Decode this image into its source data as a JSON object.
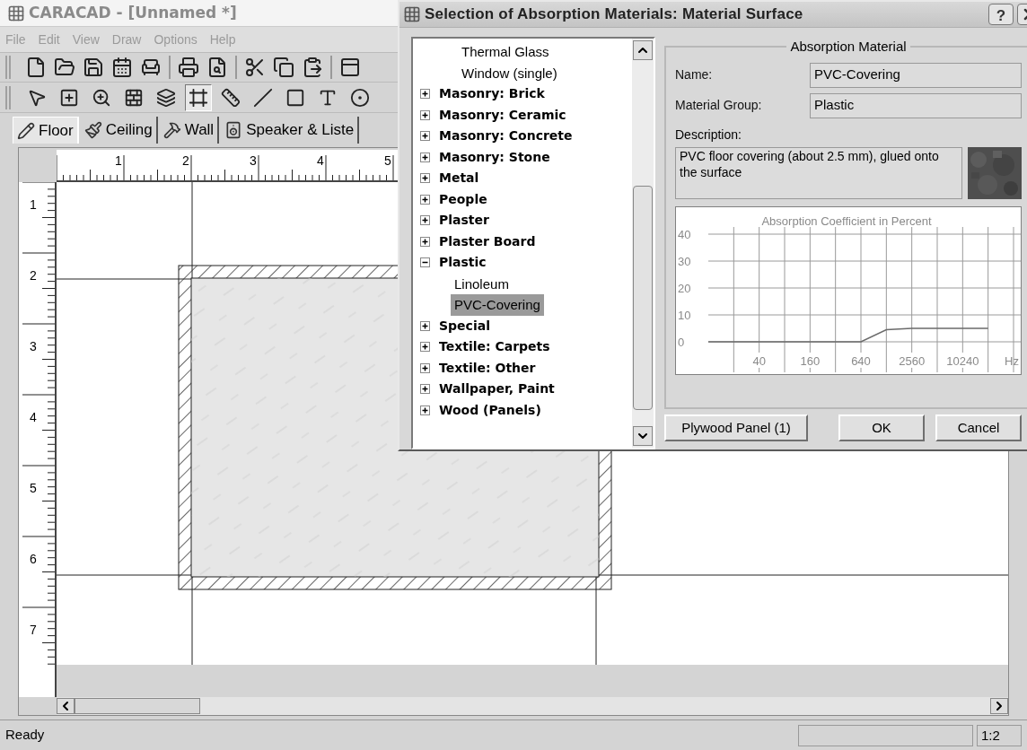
{
  "window": {
    "title": "CARACAD - [Unnamed *]"
  },
  "menu": [
    "File",
    "Edit",
    "View",
    "Draw",
    "Options",
    "Help"
  ],
  "toolbar_tools": [
    {
      "selected": false
    },
    {
      "selected": false
    },
    {
      "selected": false
    },
    {
      "selected": false
    },
    {
      "selected": false
    },
    {
      "selected": true
    },
    {
      "selected": false
    },
    {
      "selected": false
    },
    {
      "selected": false
    },
    {
      "selected": false
    },
    {
      "selected": false
    }
  ],
  "tabs": [
    {
      "label": "Floor",
      "selected": true
    },
    {
      "label": "Ceiling",
      "selected": false
    },
    {
      "label": "Wall",
      "selected": false
    },
    {
      "label": "Speaker & Liste",
      "selected": false
    }
  ],
  "ruler": {
    "horizontal": [
      "1",
      "2",
      "3",
      "4",
      "5"
    ],
    "vertical": [
      "1",
      "2",
      "3",
      "4",
      "5",
      "6",
      "7"
    ]
  },
  "status_bar": {
    "text": "Ready",
    "scale": "1:2"
  },
  "dialog": {
    "title": "Selection of Absorption Materials: Material Surface",
    "help": "?",
    "tree_top_leaves": [
      {
        "label": "Thermal Glass",
        "selected": false
      },
      {
        "label": "Window (single)",
        "selected": false
      }
    ],
    "tree": [
      {
        "label": "Masonry: Brick",
        "expanded": false
      },
      {
        "label": "Masonry: Ceramic",
        "expanded": false
      },
      {
        "label": "Masonry: Concrete",
        "expanded": false
      },
      {
        "label": "Masonry: Stone",
        "expanded": false
      },
      {
        "label": "Metal",
        "expanded": false
      },
      {
        "label": "People",
        "expanded": false
      },
      {
        "label": "Plaster",
        "expanded": false
      },
      {
        "label": "Plaster Board",
        "expanded": false
      },
      {
        "label": "Plastic",
        "expanded": true,
        "children": [
          {
            "label": "Linoleum",
            "selected": false
          },
          {
            "label": "PVC-Covering",
            "selected": true
          }
        ]
      },
      {
        "label": "Special",
        "expanded": false
      },
      {
        "label": "Textile: Carpets",
        "expanded": false
      },
      {
        "label": "Textile: Other",
        "expanded": false
      },
      {
        "label": "Wallpaper, Paint",
        "expanded": false
      },
      {
        "label": "Wood (Panels)",
        "expanded": false
      }
    ],
    "group_title": "Absorption Material",
    "fields": [
      {
        "label": "Name:",
        "value": "PVC-Covering"
      },
      {
        "label": "Material Group:",
        "value": "Plastic"
      }
    ],
    "description": {
      "label": "Description:",
      "value": "PVC floor covering (about 2.5 mm), glued onto the surface"
    },
    "chart_data": {
      "type": "line",
      "title": "Absorption Coefficient in Percent",
      "xlabel": "Hz",
      "categories": [
        null,
        null,
        "40",
        null,
        "160",
        null,
        "640",
        null,
        "2560",
        null,
        "10240",
        null
      ],
      "values": [
        0,
        0,
        0,
        0,
        0,
        0,
        0,
        4.5,
        5,
        5,
        5,
        5
      ],
      "grid": true,
      "color": "#6b6b6b",
      "ylim": [
        0,
        40
      ],
      "yticks": [
        0,
        10,
        20,
        30,
        40
      ]
    },
    "buttons": [
      "Plywood Panel (1)",
      "OK",
      "Cancel"
    ]
  }
}
